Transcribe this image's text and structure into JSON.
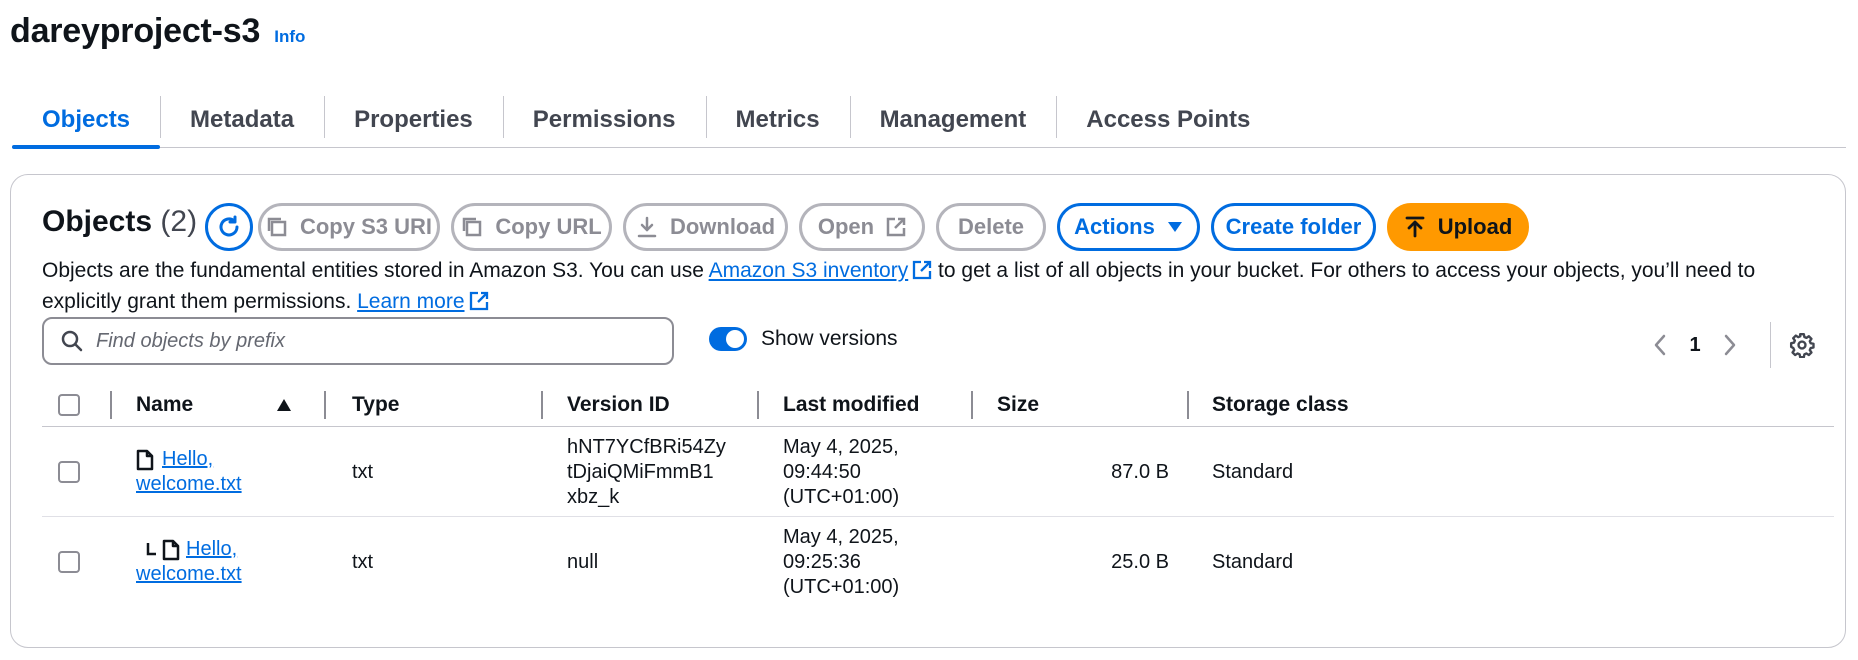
{
  "bucket": {
    "name": "dareyproject-s3",
    "info_label": "Info"
  },
  "tabs": [
    {
      "label": "Objects"
    },
    {
      "label": "Metadata"
    },
    {
      "label": "Properties"
    },
    {
      "label": "Permissions"
    },
    {
      "label": "Metrics"
    },
    {
      "label": "Management"
    },
    {
      "label": "Access Points"
    }
  ],
  "objects_panel": {
    "title": "Objects",
    "count": "(2)",
    "buttons": {
      "copy_s3_uri": "Copy S3 URI",
      "copy_url": "Copy URL",
      "download": "Download",
      "open": "Open",
      "delete": "Delete",
      "actions": "Actions",
      "create_folder": "Create folder",
      "upload": "Upload"
    },
    "description": {
      "part1": "Objects are the fundamental entities stored in Amazon S3. You can use ",
      "inventory_link": "Amazon S3 inventory",
      "part2": " to get a list of all objects in your bucket. For others to access your objects, you’ll need to explicitly grant them permissions. ",
      "learn_more": "Learn more"
    },
    "search": {
      "placeholder": "Find objects by prefix",
      "value": ""
    },
    "show_versions": {
      "label": "Show versions",
      "enabled": true
    },
    "pagination": {
      "current_page": "1"
    }
  },
  "table": {
    "columns": [
      "Name",
      "Type",
      "Version ID",
      "Last modified",
      "Size",
      "Storage class"
    ],
    "sort": {
      "column": "Name",
      "direction": "ascending"
    },
    "rows": [
      {
        "name_line1": "Hello,",
        "name_line2": "welcome.txt",
        "type": "txt",
        "version_id": [
          "hNT7YCfBRi54Zy",
          "tDjaiQMiFmmB1",
          "xbz_k"
        ],
        "last_modified": [
          "May 4, 2025,",
          "09:44:50",
          "(UTC+01:00)"
        ],
        "size": "87.0 B",
        "storage_class": "Standard",
        "is_version": false
      },
      {
        "name_line1": "Hello,",
        "name_line2": "welcome.txt",
        "type": "txt",
        "version_id": [
          "null"
        ],
        "last_modified": [
          "May 4, 2025,",
          "09:25:36",
          "(UTC+01:00)"
        ],
        "size": "25.0 B",
        "storage_class": "Standard",
        "is_version": true
      }
    ]
  },
  "colors": {
    "accent": "#006ce0",
    "upload": "#ff9900",
    "text": "#0f141a",
    "border": "#c6c6cd"
  },
  "icons": [
    "refresh-icon",
    "copy-icon",
    "download-icon",
    "external-link-icon",
    "caret-down-icon",
    "upload-icon",
    "search-icon",
    "chevron-left-icon",
    "chevron-right-icon",
    "gear-icon",
    "sort-ascending-icon",
    "file-icon",
    "version-branch-icon"
  ]
}
